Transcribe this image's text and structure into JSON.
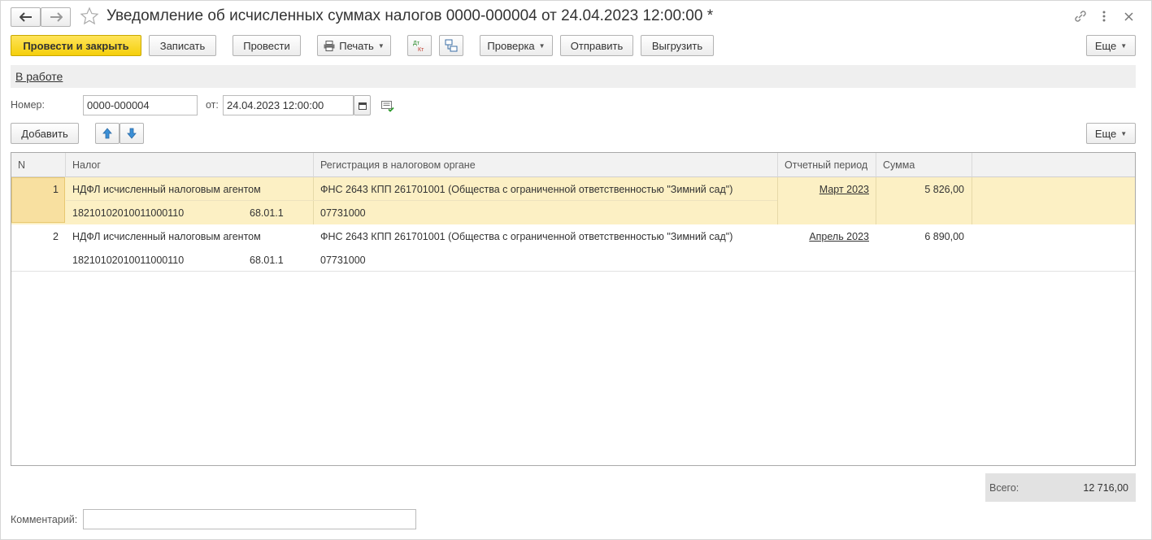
{
  "window": {
    "title": "Уведомление об исчисленных суммах налогов 0000-000004 от 24.04.2023 12:00:00 *"
  },
  "toolbar": {
    "post_close": "Провести и закрыть",
    "save": "Записать",
    "post": "Провести",
    "print": "Печать",
    "check": "Проверка",
    "send": "Отправить",
    "upload": "Выгрузить",
    "more": "Еще"
  },
  "status": {
    "label": "В работе"
  },
  "header": {
    "number_label": "Номер:",
    "number_value": "0000-000004",
    "date_label": "от:",
    "date_value": "24.04.2023 12:00:00"
  },
  "table_toolbar": {
    "add": "Добавить",
    "more": "Еще"
  },
  "table": {
    "columns": [
      "N",
      "Налог",
      "Регистрация в налоговом органе",
      "Отчетный период",
      "Сумма"
    ],
    "rows": [
      {
        "n": "1",
        "tax": "НДФЛ исчисленный налоговым агентом",
        "kbk": "18210102010011000110",
        "account": "68.01.1",
        "registration": "ФНС 2643 КПП 261701001 (Общества с ограниченной ответственностью \"Зимний сад\")",
        "oktmo": "07731000",
        "period": "Март 2023",
        "amount": "5 826,00"
      },
      {
        "n": "2",
        "tax": "НДФЛ исчисленный налоговым агентом",
        "kbk": "18210102010011000110",
        "account": "68.01.1",
        "registration": "ФНС 2643 КПП 261701001 (Общества с ограниченной ответственностью \"Зимний сад\")",
        "oktmo": "07731000",
        "period": "Апрель 2023",
        "amount": "6 890,00"
      }
    ]
  },
  "total": {
    "label": "Всего:",
    "value": "12 716,00"
  },
  "comment": {
    "label": "Комментарий:",
    "value": ""
  },
  "colors": {
    "accent": "#f5cf0b",
    "selected_row": "#fcf0c4"
  },
  "icons": [
    "back-arrow-icon",
    "forward-arrow-icon",
    "star-icon",
    "link-icon",
    "more-vertical-icon",
    "close-icon",
    "printer-icon",
    "dt-kt-icon",
    "structure-icon",
    "calendar-icon",
    "document-check-icon",
    "arrow-up-icon",
    "arrow-down-icon"
  ]
}
